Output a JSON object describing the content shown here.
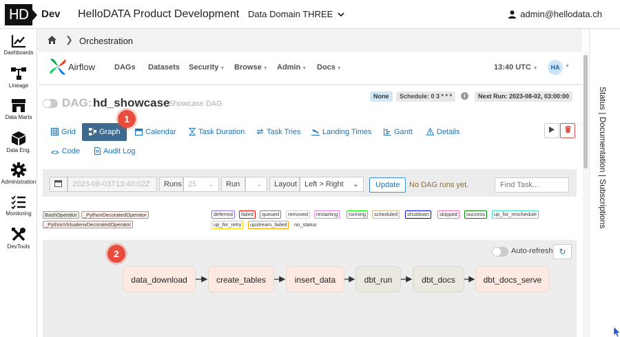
{
  "topbar": {
    "logo": "HD",
    "env": "Dev",
    "title": "HelloDATA Product Development",
    "domain": "Data Domain THREE",
    "user": "admin@hellodata.ch"
  },
  "leftnav": [
    {
      "label": "Dashboards",
      "icon": "chart-line-icon"
    },
    {
      "label": "Lineage",
      "icon": "lineage-icon"
    },
    {
      "label": "Data Marts",
      "icon": "store-icon"
    },
    {
      "label": "Data Eng.",
      "icon": "cube-icon"
    },
    {
      "label": "Administration",
      "icon": "gear-icon"
    },
    {
      "label": "Monitoring",
      "icon": "checklist-icon"
    },
    {
      "label": "DevTools",
      "icon": "tools-icon"
    }
  ],
  "breadcrumb": {
    "current": "Orchestration"
  },
  "right_tabs": "Status | Documentation | Subscriptions",
  "airflow": {
    "brand": "Airflow",
    "menu": [
      "DAGs",
      "Datasets",
      "Security",
      "Browse",
      "Admin",
      "Docs"
    ],
    "time": "13:40 UTC",
    "avatar": "HA",
    "dag_label": "DAG:",
    "dag_id": "hd_showcase",
    "dag_desc": "Showcase DAG",
    "pill_none": "None",
    "schedule": "Schedule: 0 3 * * *",
    "next_run": "Next Run: 2023-08-02, 03:00:00",
    "tabs": {
      "grid": "Grid",
      "graph": "Graph",
      "calendar": "Calendar",
      "task_duration": "Task Duration",
      "task_tries": "Task Tries",
      "landing_times": "Landing Times",
      "gantt": "Gantt",
      "details": "Details",
      "code": "Code",
      "audit_log": "Audit Log"
    },
    "controls": {
      "date": "2023-08-03T13:40:02Z",
      "runs_label": "Runs",
      "runs_value": "25",
      "run_label": "Run",
      "layout_label": "Layout",
      "layout_value": "Left > Right",
      "update": "Update",
      "no_runs": "No DAG runs yet.",
      "find_placeholder": "Find Task..."
    },
    "operators": [
      {
        "label": "BashOperator",
        "bg": "#f0ede4"
      },
      {
        "label": "_PythonDecoratedOperator",
        "bg": "#ffefeb"
      },
      {
        "label": "_PythonVirtualenvDecoratedOperator",
        "bg": "#ffefeb"
      }
    ],
    "states": [
      {
        "label": "deferred",
        "color": "#9370db"
      },
      {
        "label": "failed",
        "color": "#ff0000"
      },
      {
        "label": "queued",
        "color": "#808080"
      },
      {
        "label": "removed",
        "color": "#d3d3d3"
      },
      {
        "label": "restarting",
        "color": "#ee82ee"
      },
      {
        "label": "running",
        "color": "#00ff00"
      },
      {
        "label": "scheduled",
        "color": "#d2b48c"
      },
      {
        "label": "shutdown",
        "color": "#0000ff"
      },
      {
        "label": "skipped",
        "color": "#ff69b4"
      },
      {
        "label": "success",
        "color": "#008000"
      },
      {
        "label": "up_for_reschedule",
        "color": "#40e0d0"
      },
      {
        "label": "up_for_retry",
        "color": "#ffd700"
      },
      {
        "label": "upstream_failed",
        "color": "#ffa500"
      },
      {
        "label": "no_status",
        "color": "#ffffff"
      }
    ],
    "graph": {
      "auto_refresh": "Auto-refresh",
      "nodes": [
        "data_download",
        "create_tables",
        "insert_data",
        "dbt_run",
        "dbt_docs",
        "dbt_docs_serve"
      ]
    }
  },
  "annotations": [
    "1",
    "2"
  ]
}
